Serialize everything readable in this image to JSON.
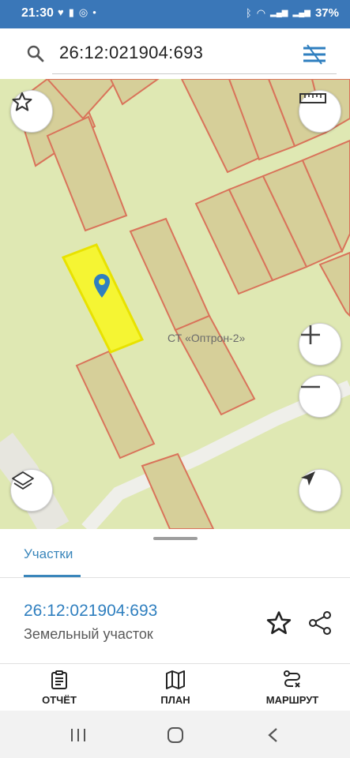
{
  "status_bar": {
    "time": "21:30",
    "left_icons": [
      "heart-icon",
      "image-icon",
      "whatsapp-icon",
      "dot-icon"
    ],
    "right_icons": [
      "bluetooth-icon",
      "wifi-icon",
      "signal-lte1-icon",
      "signal-lte2-icon"
    ],
    "battery": "37%"
  },
  "search": {
    "value": "26:12:021904:693"
  },
  "map": {
    "place_label": "СТ «Оптрон-2»",
    "parcel_highlight_color": "#f5f533",
    "parcel_outline_color": "#d9735a",
    "background_color": "#dfe8b3"
  },
  "sheet": {
    "tab": "Участки",
    "parcel_number": "26:12:021904:693",
    "parcel_type": "Земельный участок"
  },
  "nav": {
    "report": "ОТЧЁТ",
    "plan": "ПЛАН",
    "route": "МАРШРУТ"
  },
  "colors": {
    "status_bar": "#3a77b8",
    "accent": "#3a86bb"
  }
}
